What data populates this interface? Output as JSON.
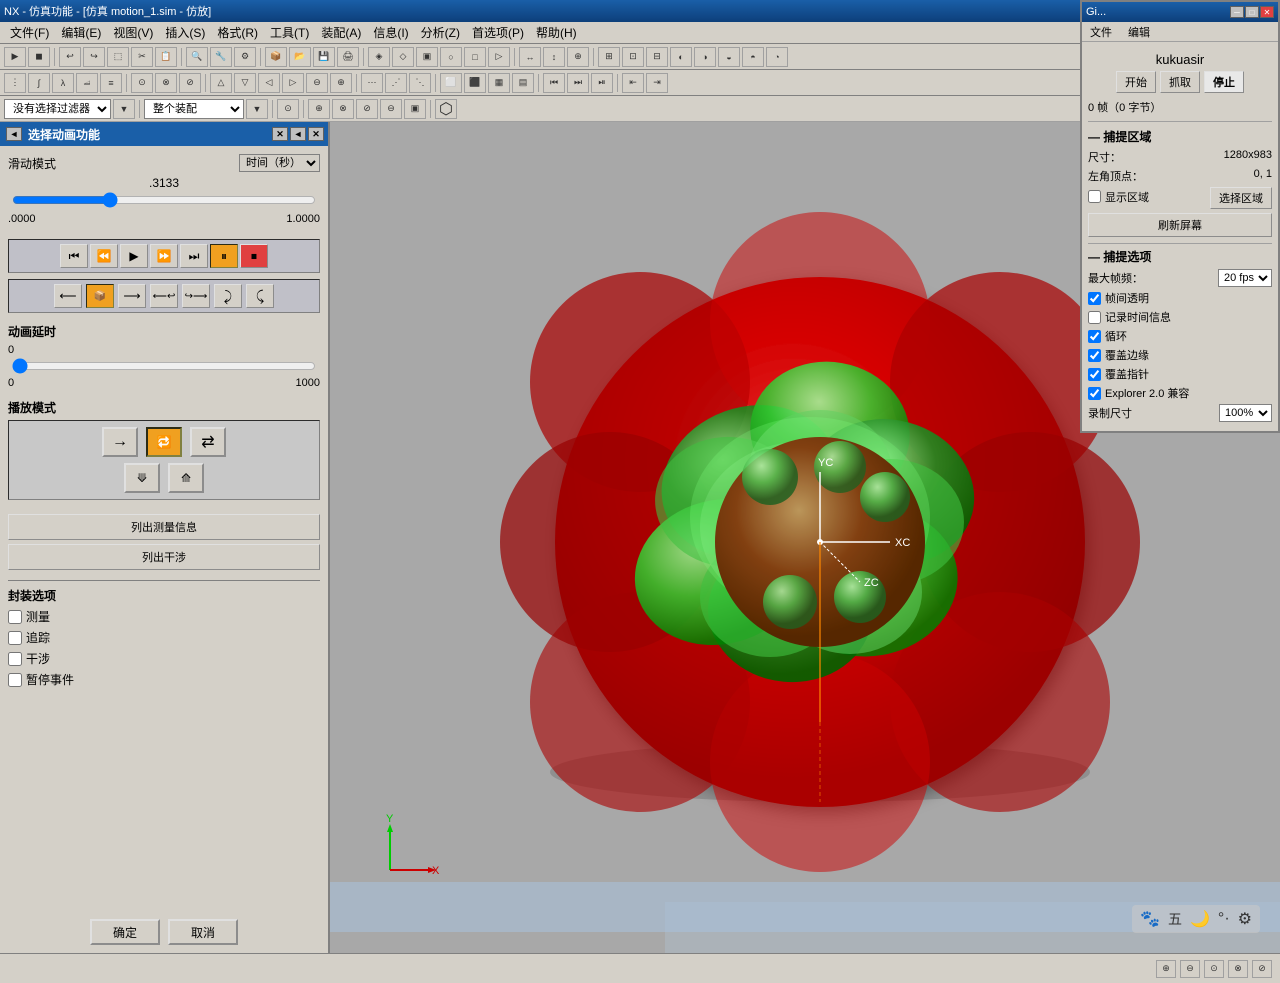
{
  "window": {
    "title": "NX - 仿真功能 - [仿真 motion_1.sim - 仿放]",
    "buttons": [
      "─",
      "□",
      "✕"
    ]
  },
  "menu": {
    "items": [
      "文件(F)",
      "编辑(E)",
      "视图(V)",
      "插入(S)",
      "格式(R)",
      "工具(T)",
      "装配(A)",
      "信息(I)",
      "分析(Z)",
      "首选项(P)",
      "帮助(H)"
    ]
  },
  "left_panel": {
    "title": "选择动画功能",
    "close_btn": "✕",
    "expand_btn": "◄",
    "pin_btn": "✕",
    "slider_section": {
      "mode_label": "滑动模式",
      "time_unit": "时间（秒）",
      "current_value": ".3133",
      "min_value": ".0000",
      "max_value": "1.0000",
      "slider_pos": 0.3133
    },
    "animation_delay": {
      "title": "动画延时",
      "min": "0",
      "max": "1000",
      "value": "0"
    },
    "play_mode": {
      "title": "播放模式"
    },
    "list_buttons": {
      "btn1": "列出测量信息",
      "btn2": "列出干涉"
    },
    "assembly": {
      "title": "封装选项",
      "checkboxes": [
        "测量",
        "追踪",
        "干涉",
        "暂停事件"
      ]
    },
    "bottom": {
      "confirm": "确定",
      "cancel": "取消"
    }
  },
  "right_panel": {
    "title": "Gi...",
    "menu_items": [
      "文件",
      "编辑"
    ],
    "username": "kukuasir",
    "buttons": {
      "start": "开始",
      "capture": "抓取",
      "stop": "停止"
    },
    "status": "0 帧（0 字节）",
    "capture_section": {
      "title": "— 捕提区域",
      "size_label": "尺寸：",
      "size_value": "1280x983",
      "corner_label": "左角顶点：",
      "corner_value": "0, 1",
      "show_area_label": "显示区域",
      "select_area_btn": "选择区域"
    },
    "refresh_btn": "刷新屏幕",
    "options_section": {
      "title": "— 捕提选项",
      "fps_label": "最大帧频：",
      "fps_value": "20 fps",
      "checkboxes": [
        {
          "label": "帧间透明",
          "checked": true
        },
        {
          "label": "记录时间信息",
          "checked": false
        },
        {
          "label": "循环",
          "checked": true
        },
        {
          "label": "覆盖边缘",
          "checked": true
        },
        {
          "label": "覆盖指针",
          "checked": true
        },
        {
          "label": "Explorer 2.0 兼容",
          "checked": true
        }
      ]
    },
    "record_size": {
      "label": "录制尺寸",
      "value": "100%"
    }
  },
  "status_bar": {
    "text": "",
    "icons": [
      "🐾",
      "五",
      "🌙",
      "°·",
      "⚙"
    ]
  },
  "viewport": {
    "background": "#b0b0b0"
  }
}
